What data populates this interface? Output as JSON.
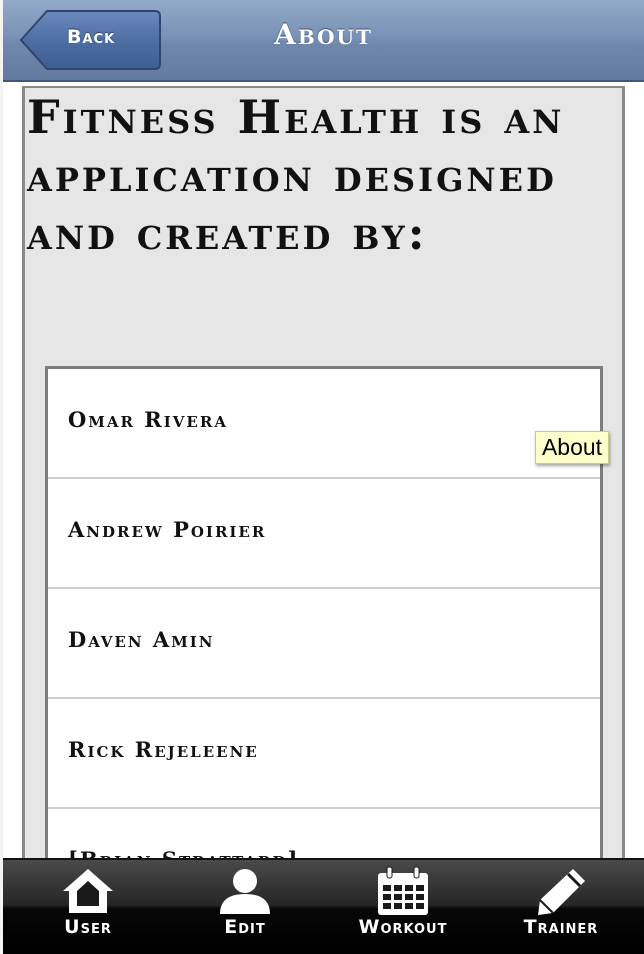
{
  "header": {
    "title": "About",
    "back_label": "Back"
  },
  "content": {
    "intro": "Fitness Health is an application designed and created by:"
  },
  "credits": [
    {
      "name": "Omar Rivera"
    },
    {
      "name": "Andrew Poirier"
    },
    {
      "name": "Daven Amin"
    },
    {
      "name": "Rick Rejeleene"
    },
    {
      "name": "[Brian Strattard]"
    }
  ],
  "tooltip": {
    "text": "About"
  },
  "tabbar": {
    "items": [
      {
        "label": "User",
        "icon": "home-icon"
      },
      {
        "label": "Edit",
        "icon": "person-icon"
      },
      {
        "label": "Workout",
        "icon": "calendar-icon"
      },
      {
        "label": "Trainer",
        "icon": "pencil-icon"
      }
    ]
  }
}
